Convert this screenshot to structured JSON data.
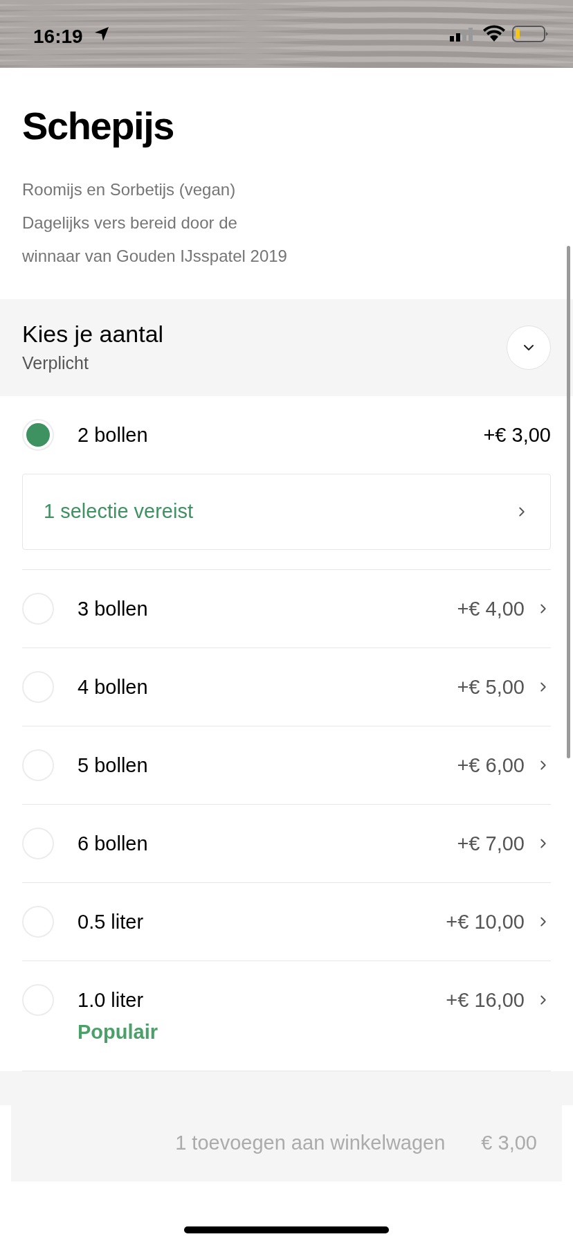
{
  "status_bar": {
    "time": "16:19"
  },
  "title": "Schepijs",
  "description_lines": [
    "Roomijs en Sorbetijs (vegan)",
    "Dagelijks vers bereid door de",
    "winnaar van Gouden IJsspatel 2019"
  ],
  "sections": [
    {
      "title": "Kies je aantal",
      "subtitle": "Verplicht",
      "expanded": true,
      "options": [
        {
          "label": "2 bollen",
          "price": "+€ 3,00",
          "selected": true,
          "requirement": "1 selectie vereist"
        },
        {
          "label": "3 bollen",
          "price": "+€ 4,00",
          "selected": false
        },
        {
          "label": "4 bollen",
          "price": "+€ 5,00",
          "selected": false
        },
        {
          "label": "5 bollen",
          "price": "+€ 6,00",
          "selected": false
        },
        {
          "label": "6 bollen",
          "price": "+€ 7,00",
          "selected": false
        },
        {
          "label": "0.5 liter",
          "price": "+€ 10,00",
          "selected": false
        },
        {
          "label": "1.0 liter",
          "price": "+€ 16,00",
          "selected": false,
          "tag": "Populair"
        }
      ]
    }
  ],
  "cart_button": {
    "label": "1 toevoegen aan winkelwagen",
    "price": "€ 3,00",
    "disabled": true
  }
}
